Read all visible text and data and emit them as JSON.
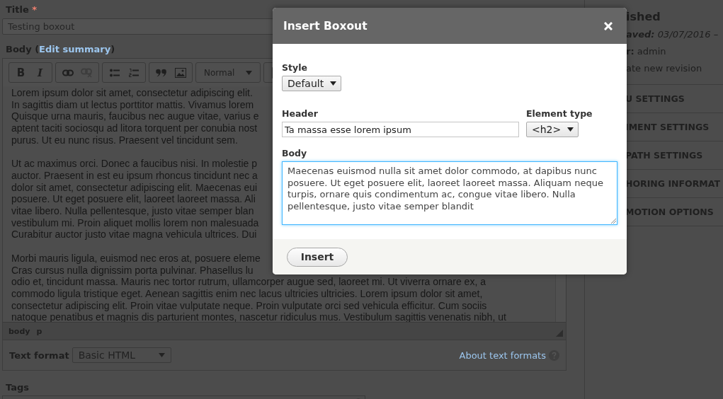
{
  "form": {
    "title_label": "Title",
    "required_mark": "*",
    "title_value": "Testing boxout",
    "body_label": "Body (",
    "summary_link": "Edit summary",
    "body_label_end": ")",
    "toolbar": [
      {
        "items": [
          {
            "kind": "bold",
            "label": "B",
            "disabled": false
          },
          {
            "kind": "italic",
            "label": "I",
            "disabled": false
          }
        ]
      },
      {
        "items": [
          {
            "kind": "link",
            "disabled": false
          },
          {
            "kind": "unlink",
            "disabled": true
          }
        ]
      },
      {
        "items": [
          {
            "kind": "bullets",
            "disabled": false
          },
          {
            "kind": "numbers",
            "disabled": false
          }
        ]
      },
      {
        "items": [
          {
            "kind": "quote",
            "disabled": false
          },
          {
            "kind": "image",
            "disabled": false
          }
        ]
      },
      {
        "items": [
          {
            "kind": "format",
            "label": "Normal",
            "disabled": false
          }
        ]
      },
      {
        "items": [
          {
            "kind": "source",
            "disabled": false
          }
        ]
      }
    ],
    "paragraphs": [
      [
        "Lorem ipsum dolor sit amet, consectetur adipiscing elit.",
        "In sagittis diam ut lectus porttitor mattis. Vivamus lorem",
        "Quisque urna mauris, faucibus nec augue vitae, varius e",
        "aptent taciti sociosqu ad litora torquent per conubia nost",
        "purus. Ut eu nunc risus. Praesent vel tincidunt sem."
      ],
      [
        "Ut ac maximus orci. Donec a faucibus nisi. In molestie p",
        "auctor. Praesent in est eu ipsum rhoncus tincidunt nec a",
        "dolor sit amet, consectetur adipiscing elit. Maecenas eui",
        "posuere. Ut eget posuere elit, laoreet laoreet massa. Ali",
        "vitae libero. Nulla pellentesque, justo vitae semper blan",
        "vestibulum mi. Proin aliquet mollis lorem non malesuada",
        "Curabitur auctor justo vitae magna vehicula ultrices. Dui"
      ],
      [
        "Morbi mauris ligula, euismod nec eros at, posuere eleme",
        "Cras cursus nulla dignissim porta pulvinar. Phasellus lu",
        "odio et, tincidunt massa. Mauris nec tortor rutrum, ullamcorper augue sed, laoreet mi. Ut viverra ornare ex, a",
        "commodo ligula tristique eget. Aenean sagittis enim nec lacus ultricies ultricies. Lorem ipsum dolor sit amet,",
        "consectetur adipiscing elit. Proin vitae vulputate neque. Proin vulputate orci sed vehicula efficitur. Cum sociis",
        "natoque penatibus et magnis dis parturient montes, nascetur ridiculus mus. Vestibulum sagittis venenatis nibh, ut"
      ]
    ],
    "path": [
      "body",
      "p"
    ],
    "format_label": "Text format",
    "format_value": "Basic HTML",
    "about_link": "About text formats",
    "tags_label": "Tags"
  },
  "sidebar": {
    "status": "ished",
    "saved_label": "aved:",
    "saved_value": "03/07/2016 –",
    "author_label": "r:",
    "author_value": "admin",
    "revision_label": "ate new revision",
    "sections": [
      "U SETTINGS",
      "IMENT SETTINGS",
      "PATH SETTINGS",
      "HORING INFORMAT",
      "MOTION OPTIONS"
    ]
  },
  "dialog": {
    "title": "Insert Boxout",
    "style_label": "Style",
    "style_value": "Default",
    "header_label": "Header",
    "header_value": "Ta massa esse lorem ipsum",
    "element_label": "Element type",
    "element_value": "<h2>",
    "body_label": "Body",
    "body_focused": true,
    "body_value": "Maecenas euismod nulla sit amet dolor commodo, at dapibus nunc posuere. Ut eget posuere elit, laoreet laoreet massa. Aliquam neque turpis, ornare quis condimentum ac, congue vitae libero. Nulla pellentesque, justo vitae semper blandit",
    "insert_button": "Insert"
  }
}
